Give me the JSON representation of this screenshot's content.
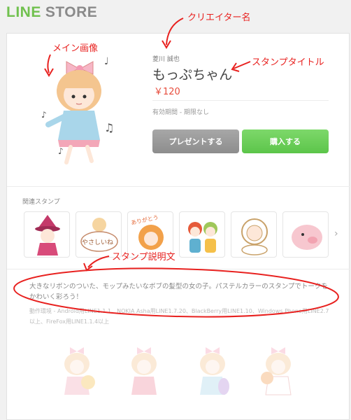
{
  "header": {
    "logo_line": "LINE",
    "logo_store": "STORE"
  },
  "product": {
    "creator": "菱川 誠也",
    "title": "もっぷちゃん",
    "price": "￥120",
    "validity": "有効期間 - 期限なし",
    "gift_button": "プレゼントする",
    "buy_button": "購入する"
  },
  "related": {
    "label": "関連スタンプ",
    "items": [
      "witch-girl",
      "やさしいね bubble",
      "ありがとう girl",
      "twin girls",
      "baby with bonnet",
      "pink pig"
    ],
    "thumb_text_1": "やさしいね",
    "thumb_text_2": "ありがとう"
  },
  "description": {
    "text": "大きなリボンのついた、モップみたいなボブの髪型の女の子。パステルカラーのスタンプでトークをかわいく彩ろう！",
    "compat": "動作環境 - Android用LINE1.1.1、NOKIA Asha用LINE1.7.20、BlackBerry用LINE1.10、Windows Phone用LINE2.7以上、FireFox用LINE1.1.4以上"
  },
  "annotations": {
    "creator": "クリエイター名",
    "main_image": "メイン画像",
    "title": "スタンプタイトル",
    "description": "スタンプ説明文"
  },
  "colors": {
    "accent_green": "#5cc54a",
    "price_red": "#e74c3c",
    "annotation_red": "#e8211f"
  }
}
